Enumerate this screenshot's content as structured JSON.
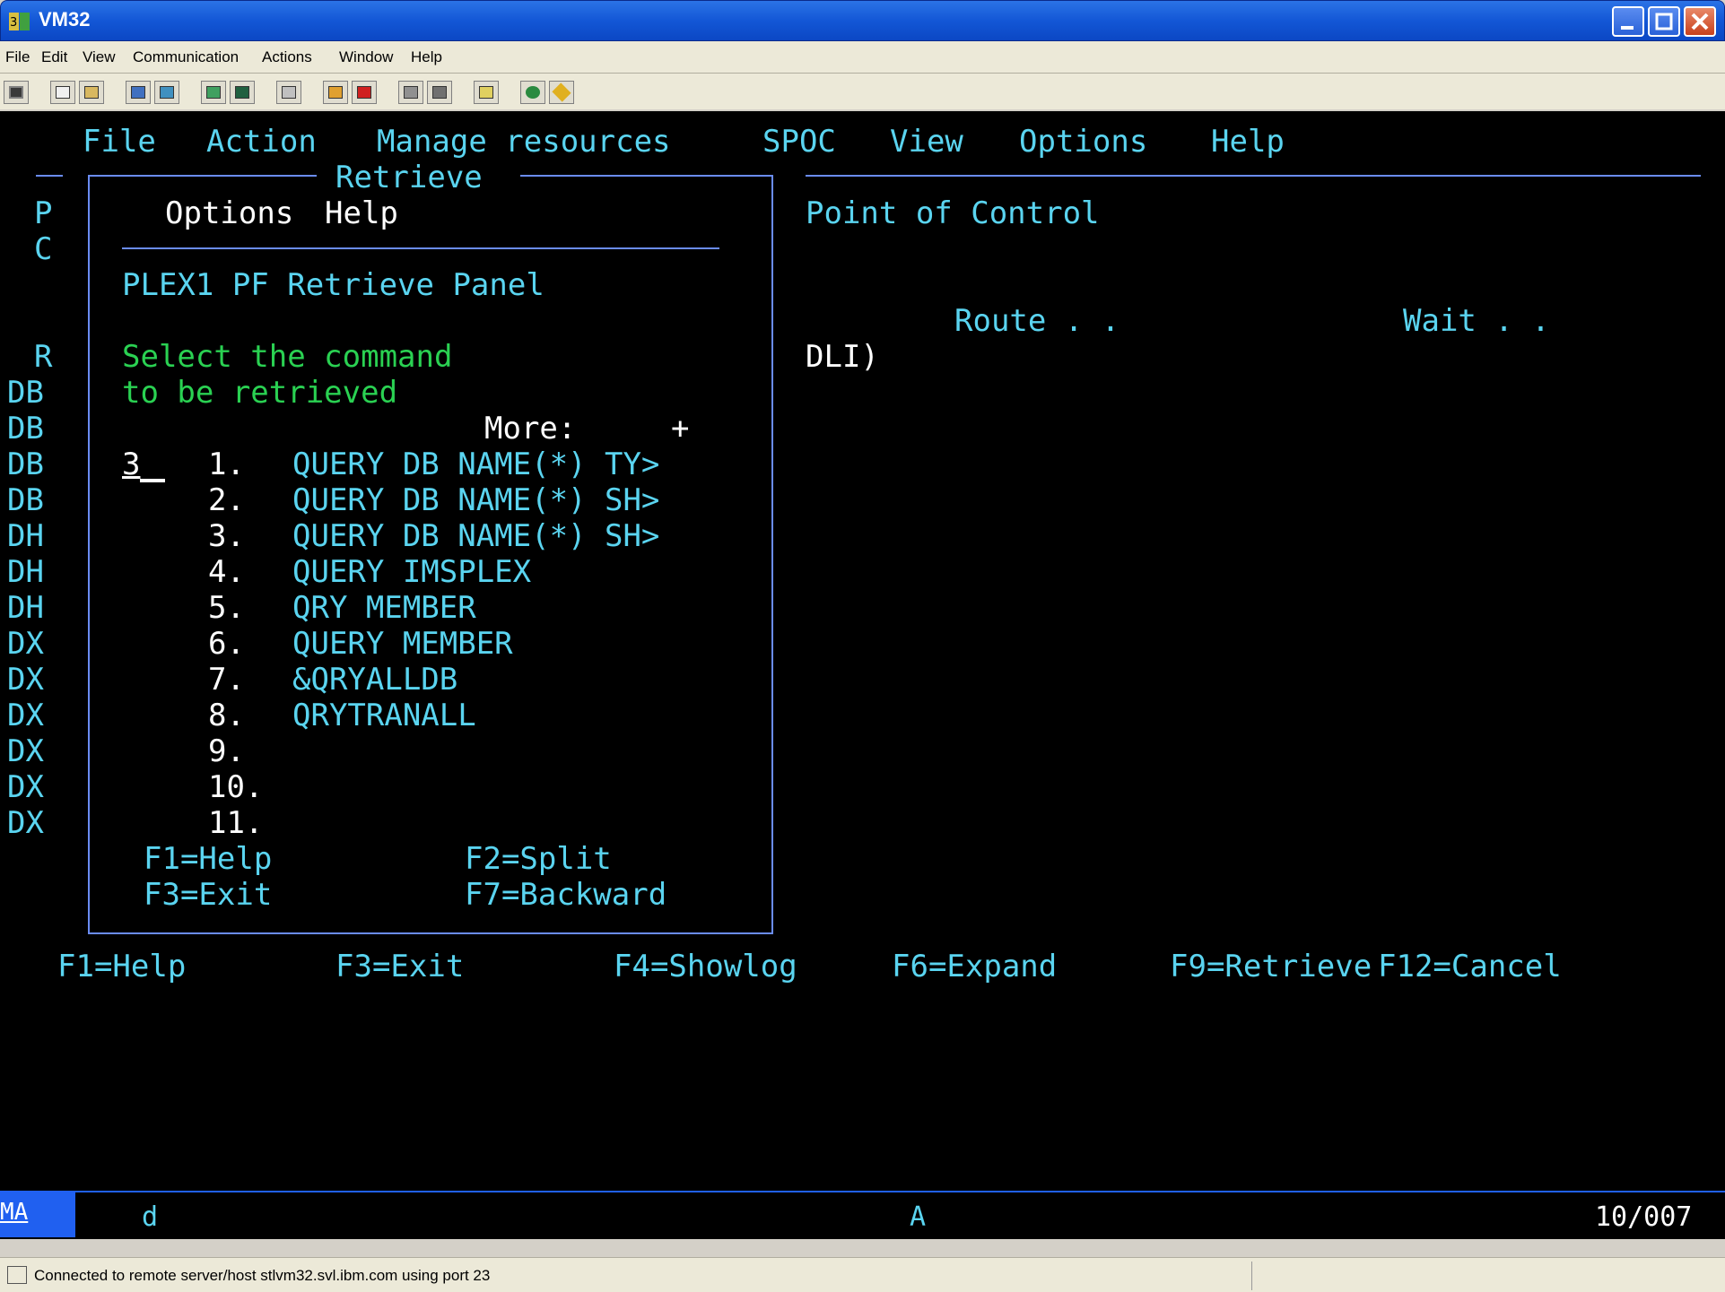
{
  "window": {
    "title": "VM32"
  },
  "menubar": {
    "items": [
      "File",
      "Edit",
      "View",
      "Communication",
      "Actions",
      "Window",
      "Help"
    ]
  },
  "toolbar": {
    "icons": [
      "screen-icon",
      "copy-icon",
      "paste-icon",
      "send-icon",
      "receive-icon",
      "keypad-icon",
      "macro-icon",
      "print-icon",
      "record-icon",
      "stop-record-icon",
      "play-icon",
      "pause-icon",
      "clipboard-icon",
      "globe-icon",
      "tag-icon"
    ]
  },
  "terminal": {
    "menu": {
      "file": "File",
      "action": "Action",
      "manage": "Manage resources",
      "spoc": "SPOC",
      "view": "View",
      "options": "Options",
      "help": "Help"
    },
    "left_col": {
      "dash": "—",
      "p": "P",
      "c": "C",
      "r": "R",
      "rows": [
        "DB",
        "DB",
        "DB",
        "DB",
        "DH",
        "DH",
        "DH",
        "DX",
        "DX",
        "DX",
        "DX",
        "DX",
        "DX"
      ]
    },
    "right": {
      "title": "Point of Control",
      "route": "Route . .",
      "wait": "Wait . .",
      "dli": "DLI)"
    },
    "popup": {
      "title": "Retrieve",
      "menu_options": "Options",
      "menu_help": "Help",
      "panel_title": "PLEX1 PF Retrieve Panel",
      "instr1": "Select the command",
      "instr2": "to be retrieved",
      "more": "More:",
      "more_sign": "+",
      "selection": "3",
      "items": [
        {
          "num": "1.",
          "cmd": "QUERY DB NAME(*) TY>"
        },
        {
          "num": "2.",
          "cmd": "QUERY DB NAME(*) SH>"
        },
        {
          "num": "3.",
          "cmd": "QUERY DB NAME(*) SH>"
        },
        {
          "num": "4.",
          "cmd": "QUERY IMSPLEX"
        },
        {
          "num": "5.",
          "cmd": "QRY MEMBER"
        },
        {
          "num": "6.",
          "cmd": "QUERY MEMBER"
        },
        {
          "num": "7.",
          "cmd": "&QRYALLDB"
        },
        {
          "num": "8.",
          "cmd": "QRYTRANALL"
        },
        {
          "num": "9.",
          "cmd": ""
        },
        {
          "num": "10.",
          "cmd": ""
        },
        {
          "num": "11.",
          "cmd": ""
        }
      ],
      "fkeys": {
        "f1": "F1=Help",
        "f2": "F2=Split",
        "f3": "F3=Exit",
        "f7": "F7=Backward"
      }
    },
    "fkeys": {
      "f1": "F1=Help",
      "f3": "F3=Exit",
      "f4": "F4=Showlog",
      "f6": "F6=Expand",
      "f9": "F9=Retrieve",
      "f12": "F12=Cancel"
    },
    "oia": {
      "ma": "MA",
      "d": "d",
      "a": "A",
      "pos": "10/007"
    }
  },
  "statusbar": {
    "message": "Connected to remote server/host stlvm32.svl.ibm.com using port 23"
  },
  "colors": {
    "terminal_bg": "#000000",
    "cyan": "#5ad4f0",
    "green": "#2ad152",
    "blue": "#6a8cf4",
    "white": "#ffffff",
    "title_bar": "#1357d6"
  }
}
